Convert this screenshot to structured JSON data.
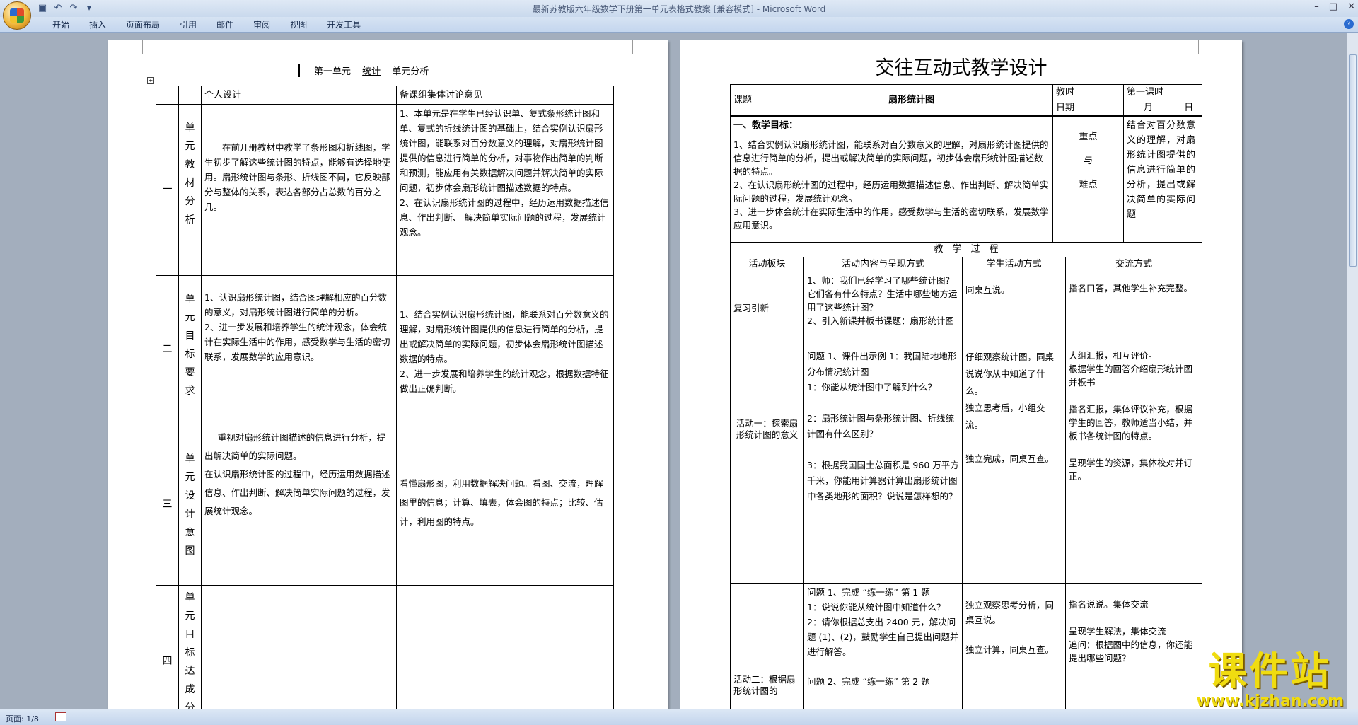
{
  "window": {
    "title": "最新苏教版六年级数学下册第一单元表格式教案 [兼容模式] - Microsoft Word"
  },
  "ribbon": {
    "tabs": [
      "开始",
      "插入",
      "页面布局",
      "引用",
      "邮件",
      "审阅",
      "视图",
      "开发工具"
    ]
  },
  "status": {
    "page": "页面: 1/8"
  },
  "left_page": {
    "heading_prefix": "第一单元",
    "heading_topic": "统计",
    "heading_suffix": "单元分析",
    "col_personal": "个人设计",
    "col_group": "备课组集体讨论意见",
    "rows": [
      {
        "num": "一",
        "label": "单元教材分析",
        "personal": "在前几册教材中教学了条形图和折线图，学生初步了解这些统计图的特点，能够有选择地使用。扇形统计图与条形、折线图不同，它反映部分与整体的关系，表达各部分占总数的百分之几。",
        "group": "1、本单元是在学生已经认识单、复式条形统计图和单、复式的折线统计图的基础上，结合实例认识扇形统计图，能联系对百分数意义的理解，对扇形统计图提供的信息进行简单的分析，对事物作出简单的判断和预测，能应用有关数据解决问题并解决简单的实际问题，初步体会扇形统计图描述数据的特点。\n2、在认识扇形统计图的过程中，经历运用数据描述信息、作出判断、 解决简单实际问题的过程，发展统计观念。"
      },
      {
        "num": "二",
        "label": "单元目标要求",
        "personal": "1、认识扇形统计图，结合图理解相应的百分数的意义，对扇形统计图进行简单的分析。\n2、进一步发展和培养学生的统计观念，体会统计在实际生活中的作用，感受数学与生活的密切联系，发展数学的应用意识。",
        "group": "1、结合实例认识扇形统计图，能联系对百分数意义的理解，对扇形统计图提供的信息进行简单的分析，提出或解决简单的实际问题，初步体会扇形统计图描述数据的特点。\n2、进一步发展和培养学生的统计观念，根据数据特征做出正确判断。"
      },
      {
        "num": "三",
        "label": "单元设计意图",
        "personal": "重视对扇形统计图描述的信息进行分析，提出解决简单的实际问题。\n在认识扇形统计图的过程中，经历运用数据描述信息、作出判断、解决简单实际问题的过程，发展统计观念。",
        "group": "看懂扇形图，利用数据解决问题。看图、交流，理解图里的信息；计算、填表，体会图的特点；比较、估计，利用图的特点。"
      },
      {
        "num": "四",
        "label": "单元目标达成分析",
        "personal": "",
        "group": ""
      }
    ]
  },
  "right_page": {
    "title": "交往互动式教学设计",
    "label_topic": "课题",
    "topic": "扇形统计图",
    "label_hours": "教时",
    "hours": "第一课时",
    "label_date": "日期",
    "date_month": "月",
    "date_day": "日",
    "goals_heading": "一、教学目标：",
    "goals": "1、结合实例认识扇形统计图，能联系对百分数意义的理解，对扇形统计图提供的信息进行简单的分析，提出或解决简单的实际问题，初步体会扇形统计图描述数据的特点。\n2、在认识扇形统计图的过程中，经历运用数据描述信息、作出判断、解决简单实际问题的过程，发展统计观念。\n3、进一步体会统计在实际生活中的作用，感受数学与生活的密切联系，发展数学应用意识。",
    "key_label_1": "重点",
    "key_label_2": "与",
    "key_label_3": "难点",
    "key_points": "结合对百分数意义的理解，对扇形统计图提供的信息进行简单的分析，提出或解决简单的实际问题",
    "process_heading": "教　学　过　程",
    "col_block": "活动板块",
    "col_content": "活动内容与呈现方式",
    "col_student": "学生活动方式",
    "col_exchange": "交流方式",
    "activities": [
      {
        "block": "复习引新",
        "content": "1、师：我们已经学习了哪些统计图？它们各有什么特点？生活中哪些地方运用了这些统计图？\n2、引入新课并板书课题：扇形统计图",
        "student": "同桌互说。",
        "exchange": "指名口答，其他学生补充完整。"
      },
      {
        "block": "活动一：探索扇形统计图的意义",
        "content": "问题 1、课件出示例 1：我国陆地地形分布情况统计图\n1：你能从统计图中了解到什么？\n\n2：扇形统计图与条形统计图、折线统计图有什么区别？\n\n3：根据我国国土总面积是 960 万平方千米，你能用计算器计算出扇形统计图中各类地形的面积？说说是怎样想的？",
        "student": "仔细观察统计图，同桌说说你从中知道了什么。\n独立思考后，小组交流。\n\n独立完成，同桌互查。",
        "exchange": "大组汇报，相互评价。\n根据学生的回答介绍扇形统计图并板书\n\n指名汇报，集体评议补充，根据学生的回答，教师适当小结，并板书各统计图的特点。\n\n呈现学生的资源，集体校对并订正。"
      },
      {
        "block": "活动二：根据扇形统计图的",
        "content": "问题 1、完成 “练一练” 第 1 题\n1：说说你能从统计图中知道什么？\n2：请你根据总支出 2400 元，解决问题 (1)、(2)，鼓励学生自己提出问题并进行解答。\n\n问题 2、完成 “练一练” 第 2 题",
        "student": "独立观察思考分析，同桌互说。\n\n独立计算，同桌互查。",
        "exchange": "指名说说。集体交流\n\n呈现学生解法，集体交流\n追问：根据图中的信息，你还能提出哪些问题？"
      }
    ]
  },
  "watermark": {
    "text": "课件站",
    "url": "www.kjzhan.com"
  }
}
